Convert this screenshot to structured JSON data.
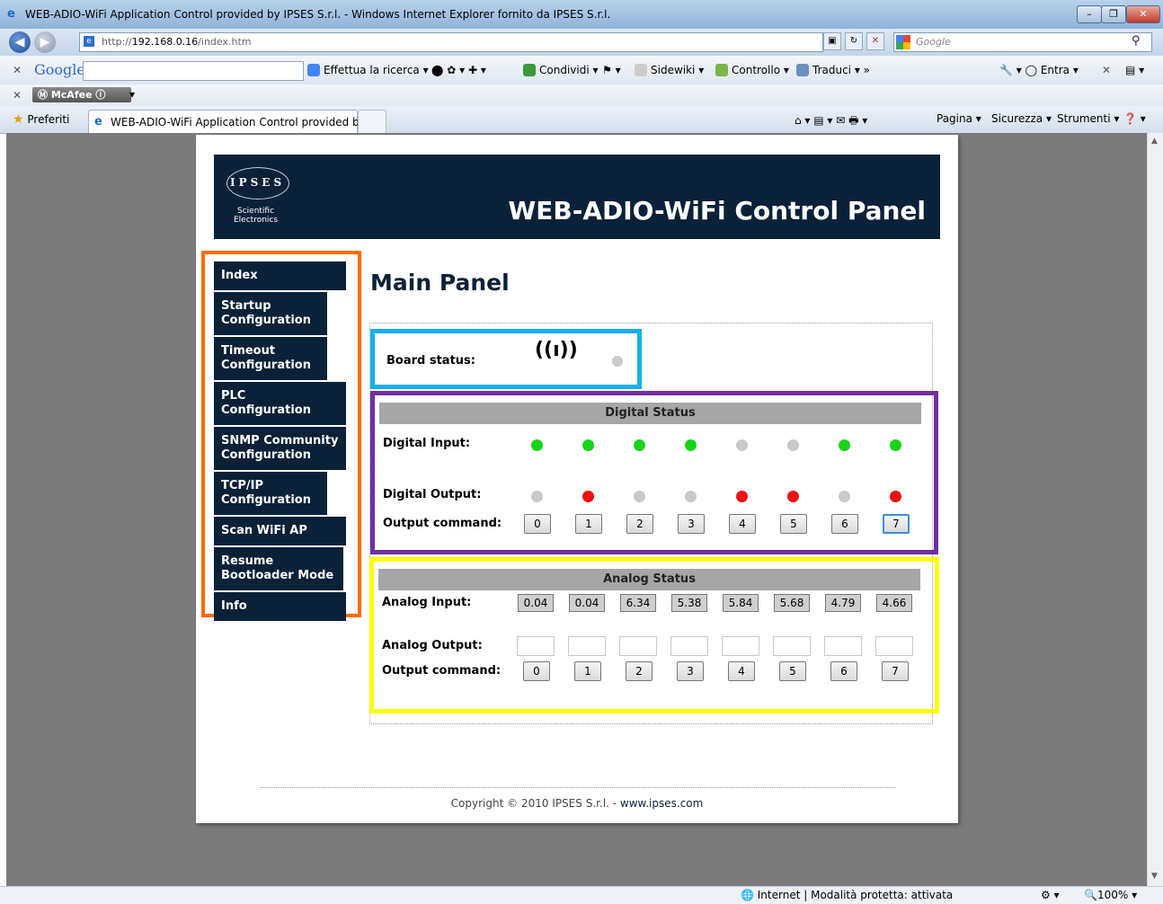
{
  "window": {
    "title": "WEB-ADIO-WiFi Application Control provided by IPSES S.r.l. - Windows Internet Explorer fornito da IPSES S.r.l.",
    "min": "–",
    "max": "❐",
    "close": "✕"
  },
  "address": {
    "url_prefix": "http://",
    "url_host": "192.168.0.16",
    "url_path": "/index.htm",
    "search_placeholder": "Google"
  },
  "google_toolbar": {
    "logo": "Google",
    "search_button": "Effettua la ricerca",
    "share": "Condividi",
    "sidewiki": "Sidewiki",
    "check": "Controllo",
    "translate": "Traduci",
    "signin": "Entra"
  },
  "mcafee": {
    "label": "McAfee"
  },
  "tabs": {
    "favorites": "Preferiti",
    "active_tab": "WEB-ADIO-WiFi Application Control provided by..."
  },
  "command_bar": {
    "page": "Pagina",
    "security": "Sicurezza",
    "tools": "Strumenti"
  },
  "banner": {
    "logo_brand": "IPSES",
    "logo_sub1": "Scientific",
    "logo_sub2": "Electronics",
    "title": "WEB-ADIO-WiFi Control Panel"
  },
  "menu": [
    "Index",
    "Startup Configuration",
    "Timeout Configuration",
    "PLC Configuration",
    "SNMP Community Configuration",
    "TCP/IP Configuration",
    "Scan WiFi AP",
    "Resume Bootloader Mode",
    "Info"
  ],
  "main": {
    "title": "Main Panel",
    "board_status_label": "Board status:",
    "antenna_icon": "((ı))",
    "board_led": "#c9c9c9"
  },
  "digital": {
    "header": "Digital Status",
    "input_label": "Digital Input:",
    "output_label": "Digital Output:",
    "command_label": "Output command:",
    "inputs": [
      "green",
      "green",
      "green",
      "green",
      "gray",
      "gray",
      "green",
      "green"
    ],
    "outputs": [
      "gray",
      "red",
      "gray",
      "gray",
      "red",
      "red",
      "gray",
      "red"
    ],
    "commands": [
      "0",
      "1",
      "2",
      "3",
      "4",
      "5",
      "6",
      "7"
    ],
    "selected_command": 7
  },
  "analog": {
    "header": "Analog Status",
    "input_label": "Analog Input:",
    "output_label": "Analog Output:",
    "command_label": "Output command:",
    "inputs": [
      "0.04",
      "0.04",
      "6.34",
      "5.38",
      "5.84",
      "5.68",
      "4.79",
      "4.66"
    ],
    "outputs": [
      "",
      "",
      "",
      "",
      "",
      "",
      "",
      ""
    ],
    "commands": [
      "0",
      "1",
      "2",
      "3",
      "4",
      "5",
      "6",
      "7"
    ]
  },
  "colors": {
    "green": "#18d418",
    "red": "#ee1111",
    "gray": "#c9c9c9",
    "navy": "#0b2138"
  },
  "footer": {
    "copyright": "Copyright © 2010 IPSES S.r.l. - ",
    "link": "www.ipses.com"
  },
  "status": {
    "zone": "Internet | Modalità protetta: attivata",
    "zoom": "100%"
  }
}
